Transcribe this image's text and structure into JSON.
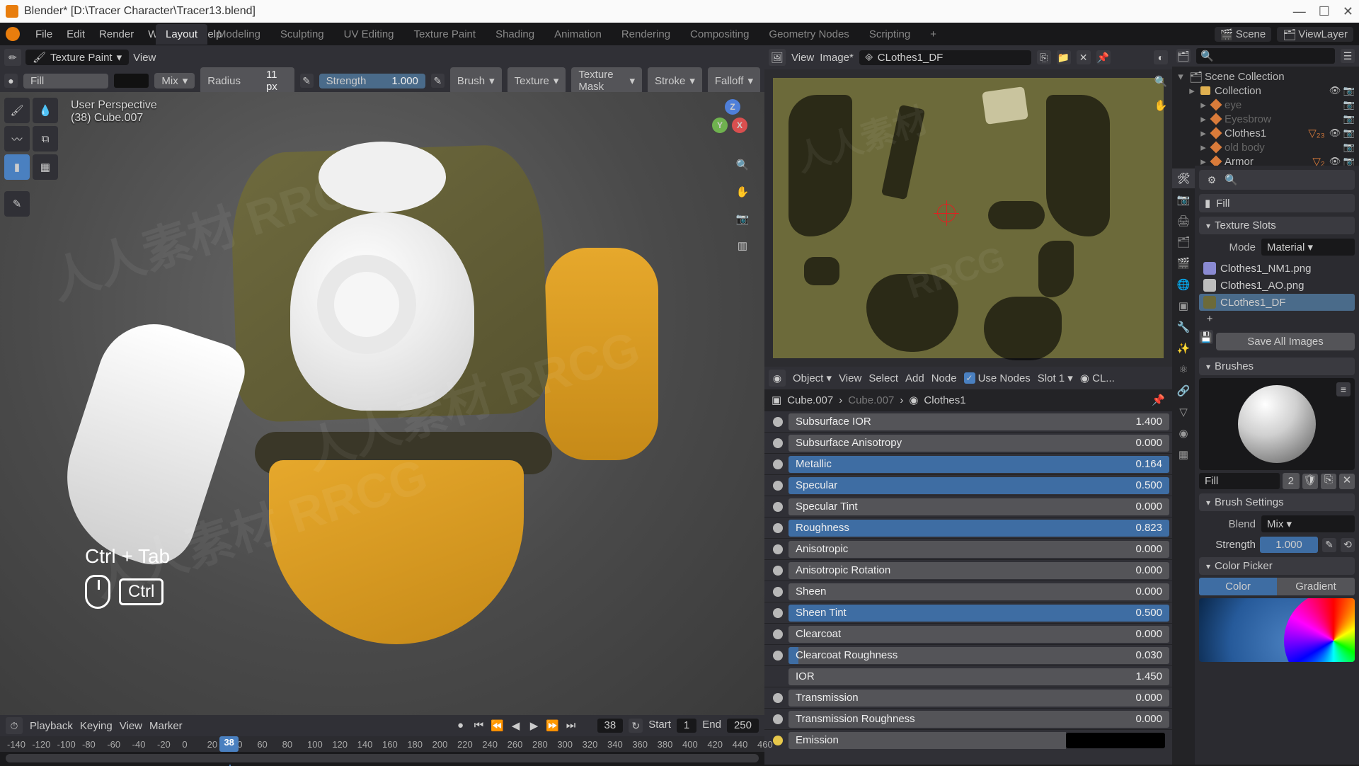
{
  "app": {
    "title": "Blender* [D:\\Tracer Character\\Tracer13.blend]"
  },
  "menu": {
    "items": [
      "File",
      "Edit",
      "Render",
      "Window",
      "Help"
    ],
    "scene_label": "Scene",
    "viewlayer_label": "ViewLayer"
  },
  "workspaces": {
    "tabs": [
      "Layout",
      "Modeling",
      "Sculpting",
      "UV Editing",
      "Texture Paint",
      "Shading",
      "Animation",
      "Rendering",
      "Compositing",
      "Geometry Nodes",
      "Scripting"
    ],
    "active_index": 0
  },
  "viewport": {
    "mode": "Texture Paint",
    "menu": [
      "View"
    ],
    "brush_name": "Fill",
    "blend_mode": "Mix",
    "radius_label": "Radius",
    "radius_value": "11 px",
    "strength_label": "Strength",
    "strength_value": "1.000",
    "dropdowns": [
      "Brush",
      "Texture",
      "Texture Mask",
      "Stroke",
      "Falloff"
    ],
    "overlay": {
      "line1": "User Perspective",
      "line2": "(38) Cube.007"
    },
    "hint": {
      "combo": "Ctrl + Tab",
      "key": "Ctrl"
    }
  },
  "uv": {
    "menu": [
      "View",
      "Image*"
    ],
    "image_name": "CLothes1_DF"
  },
  "node": {
    "type_label": "Object",
    "menu": [
      "View",
      "Select",
      "Add",
      "Node"
    ],
    "use_nodes": "Use Nodes",
    "slot": "Slot 1",
    "mat_short": "CL...",
    "crumb_obj": "Cube.007",
    "crumb_mid": "Cube.007",
    "crumb_mat": "Clothes1"
  },
  "bsdf": [
    {
      "name": "Subsurface IOR",
      "value": "1.400",
      "fill": 0.0,
      "selected": false
    },
    {
      "name": "Subsurface Anisotropy",
      "value": "0.000",
      "fill": 0.0,
      "selected": false
    },
    {
      "name": "Metallic",
      "value": "0.164",
      "fill": 0.164,
      "selected": true
    },
    {
      "name": "Specular",
      "value": "0.500",
      "fill": 0.5,
      "selected": true
    },
    {
      "name": "Specular Tint",
      "value": "0.000",
      "fill": 0.0,
      "selected": false
    },
    {
      "name": "Roughness",
      "value": "0.823",
      "fill": 0.823,
      "selected": true
    },
    {
      "name": "Anisotropic",
      "value": "0.000",
      "fill": 0.0,
      "selected": false
    },
    {
      "name": "Anisotropic Rotation",
      "value": "0.000",
      "fill": 0.0,
      "selected": false
    },
    {
      "name": "Sheen",
      "value": "0.000",
      "fill": 0.0,
      "selected": false
    },
    {
      "name": "Sheen Tint",
      "value": "0.500",
      "fill": 0.5,
      "selected": true
    },
    {
      "name": "Clearcoat",
      "value": "0.000",
      "fill": 0.0,
      "selected": false
    },
    {
      "name": "Clearcoat Roughness",
      "value": "0.030",
      "fill": 0.03,
      "selected": false
    },
    {
      "name": "IOR",
      "value": "1.450",
      "fill": 0.0,
      "selected": false,
      "noSocket": true
    },
    {
      "name": "Transmission",
      "value": "0.000",
      "fill": 0.0,
      "selected": false
    },
    {
      "name": "Transmission Roughness",
      "value": "0.000",
      "fill": 0.0,
      "selected": false
    }
  ],
  "bsdf_emission": "Emission",
  "outliner": {
    "root": "Scene Collection",
    "items": [
      {
        "name": "Collection",
        "dim": false,
        "depth": 1,
        "type": "coll",
        "suffix": ""
      },
      {
        "name": "eye",
        "dim": true,
        "depth": 2,
        "type": "obj",
        "suffix": ""
      },
      {
        "name": "Eyesbrow",
        "dim": true,
        "depth": 2,
        "type": "obj",
        "suffix": ""
      },
      {
        "name": "Clothes1",
        "dim": false,
        "depth": 2,
        "type": "obj",
        "suffix": "▽₂₃"
      },
      {
        "name": "old body",
        "dim": true,
        "depth": 2,
        "type": "obj",
        "suffix": ""
      },
      {
        "name": "Armor",
        "dim": false,
        "depth": 2,
        "type": "obj",
        "suffix": "▽₂"
      }
    ]
  },
  "tex": {
    "brush_name": "Fill",
    "slots_header": "Texture Slots",
    "mode_label": "Mode",
    "mode_value": "Material",
    "textures": [
      {
        "name": "Clothes1_NM1.png",
        "color": "#8a8ad2"
      },
      {
        "name": "Clothes1_AO.png",
        "color": "#bdbdbd"
      },
      {
        "name": "CLothes1_DF",
        "color": "#6c6a3a",
        "active": true
      }
    ],
    "save_all": "Save All Images",
    "brushes_header": "Brushes",
    "fill_label": "Fill",
    "fill_count": "2",
    "brush_settings_header": "Brush Settings",
    "blend_label": "Blend",
    "blend_value": "Mix",
    "strength_label": "Strength",
    "strength_value": "1.000",
    "picker_header": "Color Picker",
    "color_tab": "Color",
    "gradient_tab": "Gradient"
  },
  "timeline": {
    "menu": [
      "Playback",
      "Keying",
      "View",
      "Marker"
    ],
    "current": "38",
    "start_label": "Start",
    "start": "1",
    "end_label": "End",
    "end": "250",
    "ticks": [
      "-140",
      "-120",
      "-100",
      "-80",
      "-60",
      "-40",
      "-20",
      "0",
      "20",
      "40",
      "60",
      "80",
      "100",
      "120",
      "140",
      "160",
      "180",
      "200",
      "220",
      "240",
      "260",
      "280",
      "300",
      "320",
      "340",
      "360",
      "380",
      "400",
      "420",
      "440",
      "460"
    ]
  }
}
